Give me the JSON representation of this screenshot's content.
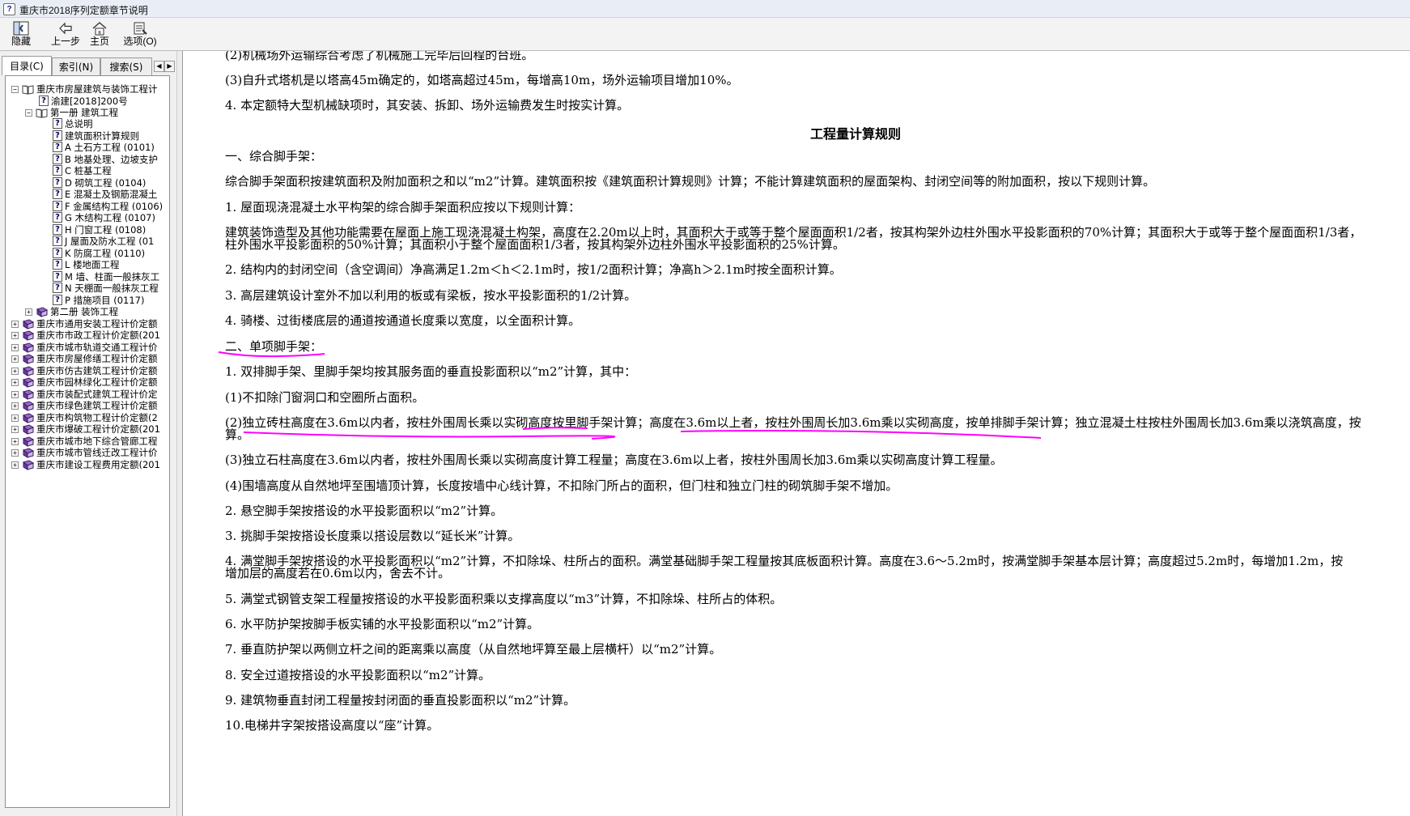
{
  "window": {
    "title": "重庆市2018序列定额章节说明"
  },
  "toolbar": {
    "hide": "隐藏",
    "back": "上一步",
    "home": "主页",
    "options": "选项(O)"
  },
  "tabs": [
    "目录(C)",
    "索引(N)",
    "搜索(S)"
  ],
  "tree": [
    "重庆市房屋建筑与装饰工程计",
    "渝建[2018]200号",
    "第一册 建筑工程",
    "总说明",
    "建筑面积计算规则",
    "A 土石方工程 (0101)",
    "B 地基处理、边坡支护",
    "C 桩基工程",
    "D 砌筑工程 (0104)",
    "E 混凝土及钢筋混凝土",
    "F 金属结构工程 (0106)",
    "G 木结构工程 (0107)",
    "H 门窗工程 (0108)",
    "J 屋面及防水工程 (01",
    "K 防腐工程 (0110)",
    "L 楼地面工程",
    "M 墙、柱面一般抹灰工",
    "N 天棚面一般抹灰工程",
    "P 措施项目 (0117)",
    "第二册 装饰工程",
    "重庆市通用安装工程计价定额",
    "重庆市市政工程计价定额(201",
    "重庆市城市轨道交通工程计价",
    "重庆市房屋修缮工程计价定额",
    "重庆市仿古建筑工程计价定额",
    "重庆市园林绿化工程计价定额",
    "重庆市装配式建筑工程计价定",
    "重庆市绿色建筑工程计价定额",
    "重庆市构筑物工程计价定额(2",
    "重庆市爆破工程计价定额(201",
    "重庆市城市地下综合管廊工程",
    "重庆市城市管线迁改工程计价",
    "重庆市建设工程费用定额(201"
  ],
  "content": {
    "heading": "工程量计算规则",
    "paragraphs": [
      "(2)机械场外运输综合考虑了机械施工完毕后回程的台班。",
      "(3)自升式塔机是以塔高45m确定的，如塔高超过45m，每增高10m，场外运输项目增加10%。",
      "4. 本定额特大型机械缺项时，其安装、拆卸、场外运输费发生时按实计算。",
      "一、综合脚手架：",
      "综合脚手架面积按建筑面积及附加面积之和以“m2”计算。建筑面积按《建筑面积计算规则》计算；不能计算建筑面积的屋面架构、封闭空间等的附加面积，按以下规则计算。",
      "1. 屋面现浇混凝土水平构架的综合脚手架面积应按以下规则计算：",
      "建筑装饰造型及其他功能需要在屋面上施工现浇混凝土构架，高度在2.20m以上时，其面积大于或等于整个屋面面积1/2者，按其构架外边柱外围水平投影面积的70%计算；其面积大于或等于整个屋面面积1/3者，",
      "柱外围水平投影面积的50%计算；其面积小于整个屋面面积1/3者，按其构架外边柱外围水平投影面积的25%计算。",
      "2. 结构内的封闭空间（含空调间）净高满足1.2m＜h＜2.1m时，按1/2面积计算；净高h＞2.1m时按全面积计算。",
      "3. 高层建筑设计室外不加以利用的板或有梁板，按水平投影面积的1/2计算。",
      "4. 骑楼、过街楼底层的通道按通道长度乘以宽度，以全面积计算。",
      "二、单项脚手架：",
      "1. 双排脚手架、里脚手架均按其服务面的垂直投影面积以“m2”计算，其中：",
      "(1)不扣除门窗洞口和空圈所占面积。",
      "(2)独立砖柱高度在3.6m以内者，按柱外围周长乘以实砌高度按里脚手架计算；高度在3.6m以上者，按柱外围周长加3.6m乘以实砌高度，按单排脚手架计算；独立混凝土柱按柱外围周长加3.6m乘以浇筑高度，按",
      "算。",
      "(3)独立石柱高度在3.6m以内者，按柱外围周长乘以实砌高度计算工程量；高度在3.6m以上者，按柱外围周长加3.6m乘以实砌高度计算工程量。",
      "(4)围墙高度从自然地坪至围墙顶计算，长度按墙中心线计算，不扣除门所占的面积，但门柱和独立门柱的砌筑脚手架不增加。",
      "2. 悬空脚手架按搭设的水平投影面积以“m2”计算。",
      "3. 挑脚手架按搭设长度乘以搭设层数以“延长米”计算。",
      "4. 满堂脚手架按搭设的水平投影面积以“m2”计算，不扣除垛、柱所占的面积。满堂基础脚手架工程量按其底板面积计算。高度在3.6～5.2m时，按满堂脚手架基本层计算；高度超过5.2m时，每增加1.2m，按",
      "增加层的高度若在0.6m以内，舍去不计。",
      "5. 满堂式钢管支架工程量按搭设的水平投影面积乘以支撑高度以“m3”计算，不扣除垛、柱所占的体积。",
      "6. 水平防护架按脚手板实铺的水平投影面积以“m2”计算。",
      "7. 垂直防护架以两侧立杆之间的距离乘以高度（从自然地坪算至最上层横杆）以“m2”计算。",
      "8. 安全过道按搭设的水平投影面积以“m2”计算。",
      "9. 建筑物垂直封闭工程量按封闭面的垂直投影面积以“m2”计算。",
      "10.电梯井字架按搭设高度以“座”计算。"
    ]
  },
  "colors": {
    "annotation": "#ff00ff",
    "tree_background": "#ffffff",
    "content_background": "#ffffff"
  }
}
